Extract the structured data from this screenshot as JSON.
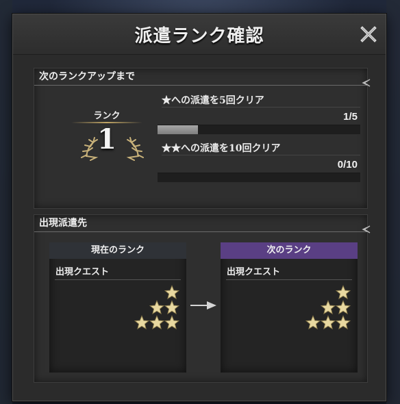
{
  "dialog": {
    "title": "派遣ランク確認"
  },
  "rank_up": {
    "header": "次のランクアップまで",
    "rank_label": "ランク",
    "rank_value": "1",
    "tasks": [
      {
        "text": "★への派遣を5回クリア",
        "count": "1/5",
        "progress": 0.2
      },
      {
        "text": "★★への派遣を10回クリア",
        "count": "0/10",
        "progress": 0.0
      }
    ]
  },
  "destinations": {
    "header": "出現派遣先",
    "current": {
      "title": "現在のランク",
      "subtitle": "出現クエスト",
      "star_tiers": [
        1,
        2,
        3
      ]
    },
    "next": {
      "title": "次のランク",
      "subtitle": "出現クエスト",
      "star_tiers": [
        1,
        2,
        3
      ]
    }
  },
  "colors": {
    "next_rank_header": "#5a3f84",
    "current_rank_header": "#2f3237",
    "rank_gold": "#c3a766",
    "star_gold": "#e8d8a0"
  },
  "icons": {
    "close": "close-icon",
    "laurel": "laurel-icon",
    "star": "star-icon",
    "arrow": "arrow-right-icon"
  }
}
